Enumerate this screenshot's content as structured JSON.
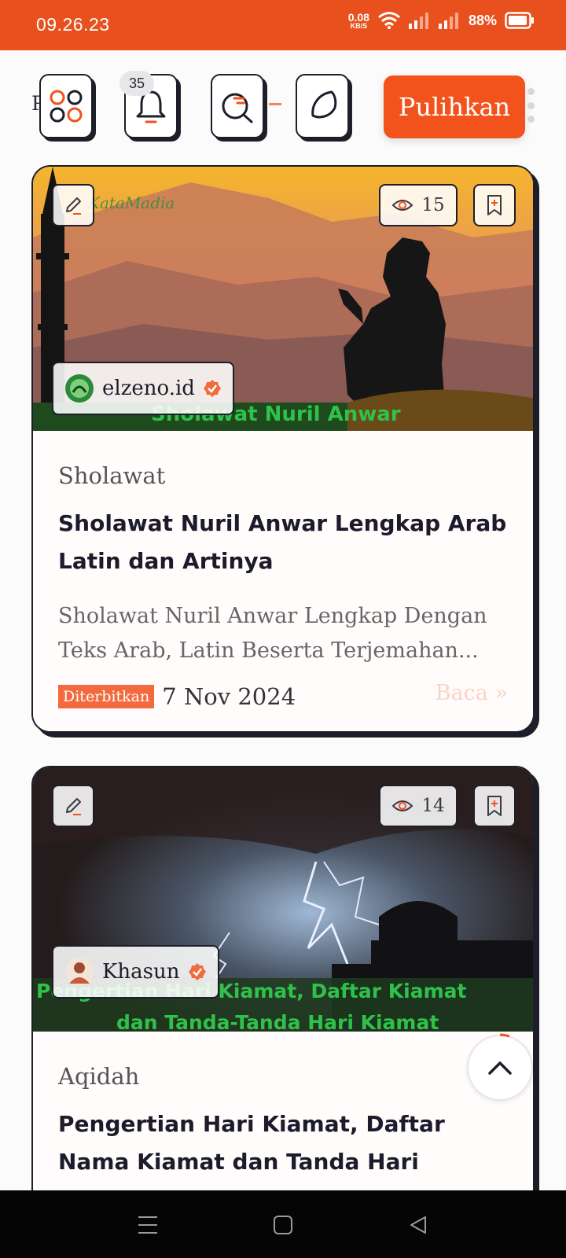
{
  "status_bar": {
    "time": "09.26.23",
    "net_speed_value": "0.08",
    "net_speed_unit": "KB/S",
    "battery": "88%"
  },
  "toolbar": {
    "partial_text": "Pi",
    "notification_count": "35",
    "restore_label": "Pulihkan",
    "icons": [
      "apps-icon",
      "bell-icon",
      "search-icon",
      "moon-icon",
      "kebab-menu-icon"
    ]
  },
  "articles": [
    {
      "category": "Sholawat",
      "title": "Sholawat Nuril Anwar Lengkap Arab Latin dan Artinya",
      "excerpt": "Sholawat Nuril Anwar Lengkap Dengan Teks Arab, Latin Beserta Terjemahan...",
      "published_label": "Diterbitkan",
      "date": "7 Nov 2024",
      "read_more": "Baca »",
      "views": "15",
      "author": "elzeno.id",
      "image_caption": "Sholawat Nuril Anwar",
      "image_watermark": "KataMadia"
    },
    {
      "category": "Aqidah",
      "title": "Pengertian Hari Kiamat, Daftar Nama Kiamat dan Tanda Hari Kiamat",
      "views": "14",
      "author": "Khasun",
      "image_caption_line1": "Pengertian Hari Kiamat, Daftar Kiamat",
      "image_caption_line2": "dan Tanda-Tanda Hari Kiamat"
    }
  ],
  "colors": {
    "accent": "#f2521c",
    "status_bar": "#e8501d",
    "verified": "#f26b3a",
    "caption_green": "#2fc24b"
  }
}
